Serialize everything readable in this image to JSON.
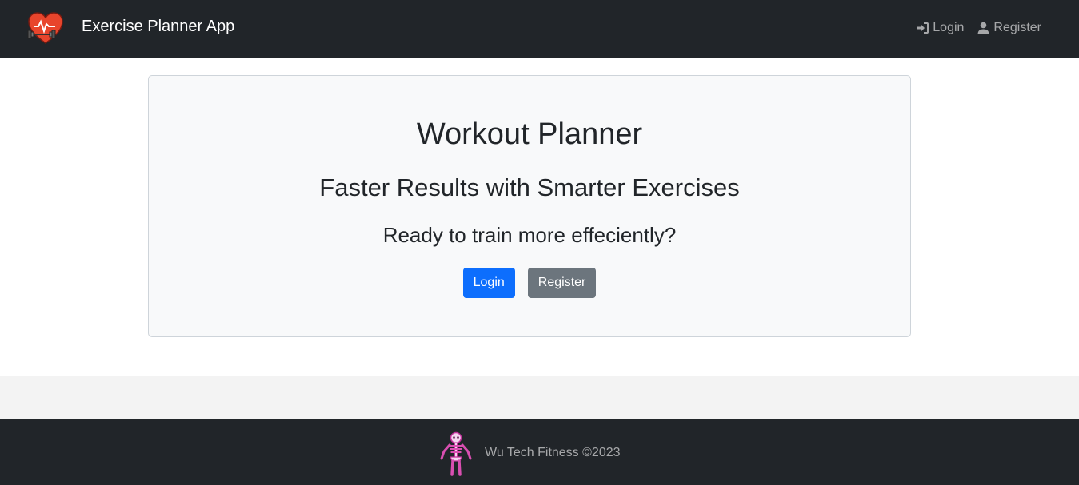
{
  "navbar": {
    "brand": "Exercise Planner App",
    "brand_icon": "heart-dumbbell-icon",
    "links": [
      {
        "label": "Login",
        "icon": "sign-in-icon"
      },
      {
        "label": "Register",
        "icon": "user-icon"
      }
    ]
  },
  "hero": {
    "title": "Workout Planner",
    "subtitle": "Faster Results with Smarter Exercises",
    "prompt": "Ready to train more effeciently?",
    "login_label": "Login",
    "register_label": "Register"
  },
  "footer": {
    "text": "Wu Tech Fitness ©2023",
    "icon": "skeleton-icon"
  },
  "colors": {
    "navbar_bg": "#212529",
    "primary": "#0d6efd",
    "secondary": "#6c757d",
    "card_bg": "#f8f9fa",
    "logo_red": "#e8452c"
  }
}
